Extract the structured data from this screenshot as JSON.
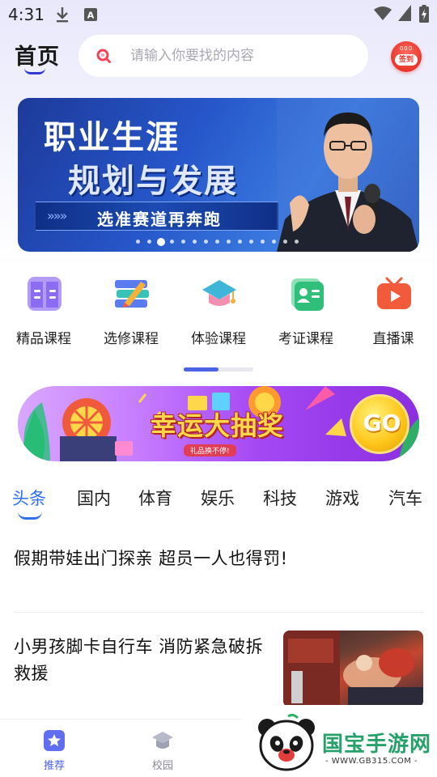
{
  "status_bar": {
    "time": "4:31"
  },
  "header": {
    "title": "首页",
    "search_placeholder": "请输入你要找的内容",
    "signin_label": "签到",
    "signin_dots": "000"
  },
  "banner": {
    "line1": "职业生涯",
    "line2": "规划与发展",
    "ribbon": "选准赛道再奔跑",
    "ribbon_arrows": "»»»",
    "page_count": 15,
    "active_page": 3
  },
  "categories": [
    {
      "label": "精品课程",
      "icon": "book-icon",
      "color": "#8c6cf2"
    },
    {
      "label": "选修课程",
      "icon": "books-pencil-icon",
      "color": "#5b7bf0"
    },
    {
      "label": "体验课程",
      "icon": "graduation-cap-icon",
      "color": "#3fb6d8"
    },
    {
      "label": "考证课程",
      "icon": "id-card-icon",
      "color": "#2fbf7a"
    },
    {
      "label": "直播课",
      "icon": "tv-play-icon",
      "color": "#f25a3c"
    }
  ],
  "category_scroll_fraction": 0.5,
  "lottery": {
    "title": "幸运大抽奖",
    "subtitle": "礼品换不停!",
    "go_label": "GO"
  },
  "news_tabs": [
    "头条",
    "国内",
    "体育",
    "娱乐",
    "科技",
    "游戏",
    "汽车"
  ],
  "active_news_tab": 0,
  "news": [
    {
      "title": "假期带娃出门探亲  超员一人也得罚!"
    },
    {
      "title": "小男孩脚卡自行车  消防紧急破拆救援"
    }
  ],
  "bottom_nav": [
    {
      "label": "推荐",
      "icon": "star-icon",
      "active": true
    },
    {
      "label": "校园",
      "icon": "campus-cap-icon",
      "active": false
    }
  ],
  "watermark": {
    "title": "国宝手游网",
    "url": "- WWW.GB315.COM -"
  },
  "colors": {
    "accent": "#2f6ff0",
    "title_underline": "#2f3ad6",
    "signin": "#e8362b",
    "nav_active": "#4b63e6",
    "nav_inactive": "#8a8a96"
  }
}
